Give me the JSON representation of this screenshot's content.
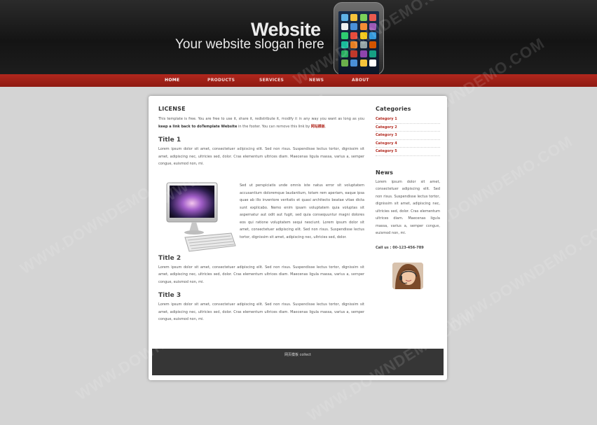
{
  "header": {
    "logo": "Website",
    "slogan": "Your website slogan here"
  },
  "nav": {
    "items": [
      "HOME",
      "PRODUCTS",
      "SERVICES",
      "NEWS",
      "ABOUT"
    ],
    "active_index": 0
  },
  "main": {
    "license_heading": "LICENSE",
    "license_text_1": "This template is free. You are free to use it, share it, redistribute it, modify it in any way you want as long as you ",
    "license_bold": "keep a link back to doTemplate Website",
    "license_text_2": " in the footer. You can remove this link by ",
    "license_link": "网站模板",
    "license_text_3": ".",
    "title1": "Title 1",
    "title1_text": "Lorem ipsum dolor sit amet, consectetuer adipiscing elit. Sed non risus. Suspendisse lectus tortor, dignissim sit amet, adipiscing nec, ultricies sed, dolor. Cras elementum ultrices diam. Maecenas ligula massa, varius a, semper congue, euismod non, mi.",
    "float_text": "Sed ut perspiciatis unde omnis iste natus error sit voluptatem accusantium doloremque laudantium, totam rem aperiam, eaque ipsa quae ab illo inventore veritatis et quasi architecto beatae vitae dicta sunt explicabo. Nemo enim ipsam voluptatem quia voluptas sit aspernatur aut odit aut fugit, sed quia consequuntur magni dolores eos qui ratione voluptatem sequi nesciunt. Lorem ipsum dolor sit amet, consectetuer adipiscing elit. Sed non risus. Suspendisse lectus tortor, dignissim sit amet, adipiscing nec, ultricies sed, dolor.",
    "title2": "Title 2",
    "title2_text": "Lorem ipsum dolor sit amet, consectetuer adipiscing elit. Sed non risus. Suspendisse lectus tortor, dignissim sit amet, adipiscing nec, ultricies sed, dolor. Cras elementum ultrices diam. Maecenas ligula massa, varius a, semper congue, euismod non, mi.",
    "title3": "Title 3",
    "title3_text": "Lorem ipsum dolor sit amet, consectetuer adipiscing elit. Sed non risus. Suspendisse lectus tortor, dignissim sit amet, adipiscing nec, ultricies sed, dolor. Cras elementum ultrices diam. Maecenas ligula massa, varius a, semper congue, euismod non, mi."
  },
  "sidebar": {
    "categories_heading": "Categories",
    "categories": [
      "Category 1",
      "Category 2",
      "Category 3",
      "Category 4",
      "Category 5"
    ],
    "news_heading": "News",
    "news_text": "Lorem ipsum dolor sit amet, consectetuer adipiscing elit. Sed non risus. Suspendisse lectus tortor, dignissim sit amet, adipiscing nec, ultricies sed, dolor. Cras elementum ultrices diam. Maecenas ligula massa, varius a, semper congue, euismod non, mi.",
    "call_us": "Call us : 00-123-456-789"
  },
  "footer": {
    "text": "网页模板 collect"
  },
  "watermark": "WWW.DOWNDEMO.COM",
  "colors": {
    "accent": "#b1271d",
    "header_bg": "#1a1a1a",
    "page_bg": "#d4d4d4",
    "footer_bg": "#363636"
  }
}
